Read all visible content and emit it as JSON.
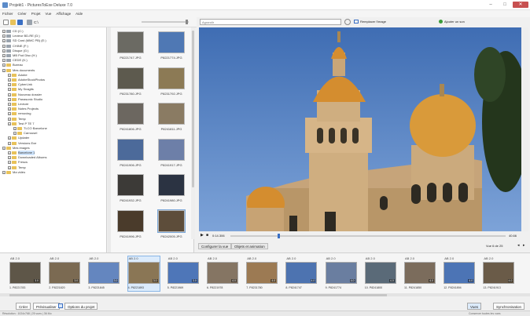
{
  "window": {
    "title": "Projekt1 - PicturesToExe Deluxe 7.0"
  },
  "menu": [
    "Fichier",
    "Créer",
    "Projet",
    "Vue",
    "Affichage",
    "Aide"
  ],
  "toolbar": {
    "path": "C:\\"
  },
  "viewer_toolbar": {
    "search_placeholder": "Agrandir",
    "fit_label": "Remplacer l'image",
    "add_label": "Ajouter un son"
  },
  "tree": [
    {
      "label": "CD (C:)",
      "depth": 0,
      "icon": "drive"
    },
    {
      "label": "Lecteur BD-RE (D:)",
      "depth": 0,
      "icon": "drive"
    },
    {
      "label": "SD Card (MMC PB) (E:)",
      "depth": 0,
      "icon": "drive"
    },
    {
      "label": "CHINE (F:)",
      "depth": 0,
      "icon": "drive"
    },
    {
      "label": "Disque (G:)",
      "depth": 0,
      "icon": "drive"
    },
    {
      "label": "MB Pod Disc (H:)",
      "depth": 0,
      "icon": "drive"
    },
    {
      "label": "CEDE (K:)",
      "depth": 0,
      "icon": "drive"
    },
    {
      "label": "Bureau",
      "depth": 0,
      "icon": "folder"
    },
    {
      "label": "Mes documents",
      "depth": 0,
      "icon": "folder"
    },
    {
      "label": "Adobe",
      "depth": 1,
      "icon": "folder"
    },
    {
      "label": "AdobeStockPhotos",
      "depth": 1,
      "icon": "folder"
    },
    {
      "label": "CyberLink",
      "depth": 1,
      "icon": "folder"
    },
    {
      "label": "My Snagits",
      "depth": 1,
      "icon": "folder"
    },
    {
      "label": "Nouveau dossier",
      "depth": 1,
      "icon": "folder"
    },
    {
      "label": "Panasonic Studio",
      "depth": 1,
      "icon": "folder"
    },
    {
      "label": "Lecture",
      "depth": 1,
      "icon": "folder"
    },
    {
      "label": "Notes Projects",
      "depth": 1,
      "icon": "folder"
    },
    {
      "label": "removing",
      "depth": 1,
      "icon": "folder"
    },
    {
      "label": "Temp",
      "depth": 1,
      "icon": "folder"
    },
    {
      "label": "Test P TE 7",
      "depth": 1,
      "icon": "folder"
    },
    {
      "label": "TLCO Barcelone",
      "depth": 2,
      "icon": "folder"
    },
    {
      "label": "Carrousel",
      "depth": 2,
      "icon": "folder"
    },
    {
      "label": "Updater",
      "depth": 1,
      "icon": "folder"
    },
    {
      "label": "Versions Exe",
      "depth": 1,
      "icon": "folder"
    },
    {
      "label": "Mes images",
      "depth": 0,
      "icon": "folder"
    },
    {
      "label": "Barcelone 1",
      "depth": 1,
      "icon": "folder",
      "selected": true
    },
    {
      "label": "Downloaded Albums",
      "depth": 1,
      "icon": "folder"
    },
    {
      "label": "Frescs",
      "depth": 1,
      "icon": "folder"
    },
    {
      "label": "Temp",
      "depth": 1,
      "icon": "folder"
    },
    {
      "label": "Ma vidéo",
      "depth": 0,
      "icon": "folder"
    }
  ],
  "thumbs": [
    "P8221747.JPG",
    "P8221774.JPG",
    "P8231780.JPG",
    "P8231792.JPG",
    "P8241806.JPG",
    "P8241811.JPG",
    "P8241906.JPG",
    "P8241917.JPG",
    "P8241932.JPG",
    "P8241980.JPG",
    "P8241996.JPG",
    "P8242005.JPG"
  ],
  "player": {
    "time_start": "0:14.306",
    "time_end": "40.66"
  },
  "viewer_tabs": {
    "tab1": "Configurer la vue",
    "tab2": "Objets et animation",
    "slide_counter": "Vue 6 de 25"
  },
  "filmstrip": [
    {
      "time": "AB 2.0",
      "caption": "1. P8221783",
      "num": "3.0"
    },
    {
      "time": "AB 2.0",
      "caption": "2. P8221820",
      "num": "3.0"
    },
    {
      "time": "AB 2.0",
      "caption": "3. P8221845",
      "num": "3.0"
    },
    {
      "time": "AB 2.0",
      "caption": "4. P8221893",
      "num": "3.0",
      "selected": true
    },
    {
      "time": "AB 2.0",
      "caption": "5. P8221969",
      "num": "3.0"
    },
    {
      "time": "AB 2.0",
      "caption": "6. P8221978",
      "num": "4.0"
    },
    {
      "time": "AB 2.0",
      "caption": "7. P8231780",
      "num": "4.0"
    },
    {
      "time": "AB 2.0",
      "caption": "8. P8241747",
      "num": "4.0"
    },
    {
      "time": "AB 2.0",
      "caption": "9. P8241774",
      "num": "4.0"
    },
    {
      "time": "AB 2.0",
      "caption": "10. P8241800",
      "num": "4.0"
    },
    {
      "time": "AB 2.0",
      "caption": "11. P8241850",
      "num": "4.0"
    },
    {
      "time": "AB 2.0",
      "caption": "12. P8241894",
      "num": "4.0"
    },
    {
      "time": "AB 2.0",
      "caption": "13. P8241913",
      "num": "4.0"
    }
  ],
  "bottom": {
    "btn_create": "Créer",
    "btn_preview": "Prévisualiser",
    "btn_options": "Options du projet",
    "btn_views": "Vues",
    "btn_sync": "Synchronisation"
  },
  "status": {
    "left": "Résolution : 1024x768 | 25 vues | 36 Mo",
    "right": "Conserver toutes les vues"
  },
  "colors": {
    "sky": "#4f7dc0",
    "stone": "#c9a57a",
    "dome": "#d79b3a",
    "selection": "#cfe4fb",
    "accent": "#4a8ad4"
  }
}
